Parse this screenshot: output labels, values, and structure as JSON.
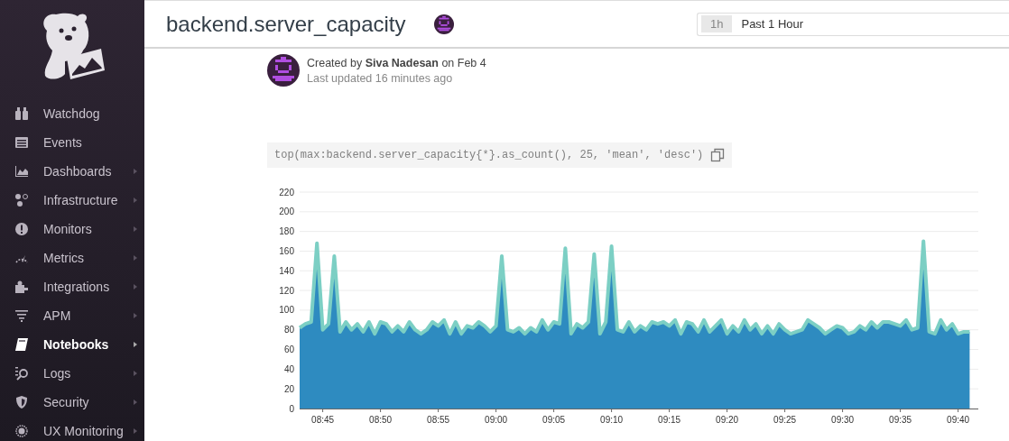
{
  "sidebar": {
    "items": [
      {
        "label": "Watchdog",
        "selected": false,
        "submenu": false
      },
      {
        "label": "Events",
        "selected": false,
        "submenu": false
      },
      {
        "label": "Dashboards",
        "selected": false,
        "submenu": true
      },
      {
        "label": "Infrastructure",
        "selected": false,
        "submenu": true
      },
      {
        "label": "Monitors",
        "selected": false,
        "submenu": true
      },
      {
        "label": "Metrics",
        "selected": false,
        "submenu": true
      },
      {
        "label": "Integrations",
        "selected": false,
        "submenu": true
      },
      {
        "label": "APM",
        "selected": false,
        "submenu": true
      },
      {
        "label": "Notebooks",
        "selected": true,
        "submenu": true
      },
      {
        "label": "Logs",
        "selected": false,
        "submenu": true
      },
      {
        "label": "Security",
        "selected": false,
        "submenu": true
      },
      {
        "label": "UX Monitoring",
        "selected": false,
        "submenu": true
      }
    ]
  },
  "header": {
    "title": "backend.server_capacity",
    "time_range": {
      "badge": "1h",
      "label": "Past 1 Hour"
    }
  },
  "meta": {
    "created": "Created by **Siva Nadesan** on Feb 4",
    "updated": "Last updated 16 minutes ago"
  },
  "query": "top(max:backend.server_capacity{*}.as_count(), 25, 'mean', 'desc')",
  "chart_data": {
    "type": "area",
    "grid": true,
    "ylim": [
      0,
      220
    ],
    "yticks": [
      0,
      20,
      40,
      60,
      80,
      100,
      120,
      140,
      160,
      180,
      200,
      220
    ],
    "categories": [
      null,
      null,
      null,
      null,
      "08:45",
      null,
      null,
      null,
      null,
      null,
      null,
      null,
      null,
      null,
      "08:50",
      null,
      null,
      null,
      null,
      null,
      null,
      null,
      null,
      null,
      "08:55",
      null,
      null,
      null,
      null,
      null,
      null,
      null,
      null,
      null,
      "09:00",
      null,
      null,
      null,
      null,
      null,
      null,
      null,
      null,
      null,
      "09:05",
      null,
      null,
      null,
      null,
      null,
      null,
      null,
      null,
      null,
      "09:10",
      null,
      null,
      null,
      null,
      null,
      null,
      null,
      null,
      null,
      "09:15",
      null,
      null,
      null,
      null,
      null,
      null,
      null,
      null,
      null,
      "09:20",
      null,
      null,
      null,
      null,
      null,
      null,
      null,
      null,
      null,
      "09:25",
      null,
      null,
      null,
      null,
      null,
      null,
      null,
      null,
      null,
      "09:30",
      null,
      null,
      null,
      null,
      null,
      null,
      null,
      null,
      null,
      "09:35",
      null,
      null,
      null,
      null,
      null,
      null,
      null,
      null,
      null,
      "09:40",
      null,
      null
    ],
    "series": [
      {
        "color": "#2e8bc0",
        "values": [
          82,
          86,
          88,
          168,
          80,
          86,
          155,
          78,
          88,
          80,
          86,
          78,
          88,
          76,
          88,
          86,
          78,
          84,
          78,
          88,
          80,
          76,
          80,
          88,
          84,
          90,
          76,
          88,
          76,
          84,
          82,
          88,
          84,
          78,
          84,
          155,
          80,
          78,
          82,
          76,
          82,
          78,
          90,
          80,
          88,
          86,
          163,
          76,
          86,
          82,
          88,
          157,
          76,
          88,
          165,
          80,
          78,
          88,
          78,
          84,
          80,
          88,
          86,
          88,
          84,
          90,
          76,
          88,
          86,
          78,
          90,
          78,
          84,
          90,
          76,
          84,
          78,
          90,
          80,
          86,
          76,
          84,
          76,
          86,
          80,
          76,
          78,
          80,
          90,
          86,
          82,
          76,
          80,
          84,
          82,
          76,
          78,
          84,
          80,
          88,
          82,
          88,
          88,
          86,
          84,
          90,
          80,
          82,
          170,
          78,
          76,
          90,
          80,
          86,
          76,
          78,
          78
        ]
      }
    ]
  }
}
